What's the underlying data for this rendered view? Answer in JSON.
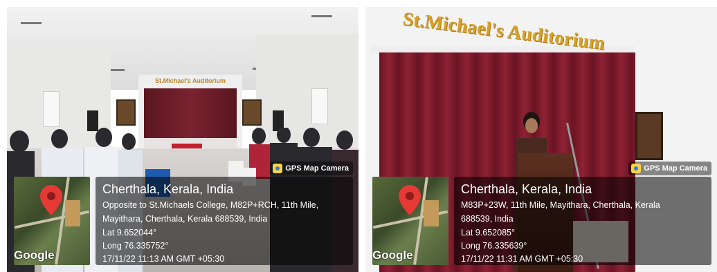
{
  "photos": [
    {
      "signage": "St.Michael's Auditorium",
      "badge": "GPS Map Camera",
      "map_logo": "Google",
      "location_title": "Cherthala, Kerala, India",
      "address_line1": "Opposite to St.Michaels College, M82P+RCH, 11th Mile,",
      "address_line2": "Mayithara, Cherthala, Kerala 688539, India",
      "lat": "Lat 9.652044°",
      "long": "Long 76.335752°",
      "timestamp": "17/11/22 11:13 AM GMT +05:30"
    },
    {
      "signage": "St.Michael's Auditorium",
      "badge": "GPS Map Camera",
      "map_logo": "Google",
      "location_title": "Cherthala, Kerala, India",
      "address_line1": "M83P+23W, 11th Mile, Mayithara, Cherthala, Kerala",
      "address_line2": "688539, India",
      "lat": "Lat 9.652085°",
      "long": "Long 76.335639°",
      "timestamp": "17/11/22 11:31 AM GMT +05:30"
    }
  ],
  "colors": {
    "signage_gold": "#d6a12a",
    "curtain_maroon": "#7a2230",
    "pin_red": "#e53935"
  },
  "icons": [
    "map-pin-icon",
    "gps-camera-icon"
  ]
}
